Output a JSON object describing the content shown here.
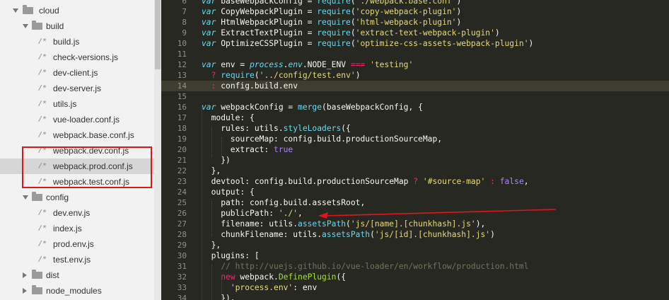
{
  "sidebar": {
    "items": [
      {
        "type": "folder",
        "state": "open",
        "depth": 0,
        "label": "cloud"
      },
      {
        "type": "folder",
        "state": "open",
        "depth": 1,
        "label": "build"
      },
      {
        "type": "file",
        "depth": 2,
        "icon": "/*",
        "label": "build.js"
      },
      {
        "type": "file",
        "depth": 2,
        "icon": "/*",
        "label": "check-versions.js"
      },
      {
        "type": "file",
        "depth": 2,
        "icon": "/*",
        "label": "dev-client.js"
      },
      {
        "type": "file",
        "depth": 2,
        "icon": "/*",
        "label": "dev-server.js"
      },
      {
        "type": "file",
        "depth": 2,
        "icon": "/*",
        "label": "utils.js"
      },
      {
        "type": "file",
        "depth": 2,
        "icon": "/*",
        "label": "vue-loader.conf.js"
      },
      {
        "type": "file",
        "depth": 2,
        "icon": "/*",
        "label": "webpack.base.conf.js"
      },
      {
        "type": "file",
        "depth": 2,
        "icon": "/*",
        "label": "webpack.dev.conf.js"
      },
      {
        "type": "file",
        "depth": 2,
        "icon": "/*",
        "label": "webpack.prod.conf.js",
        "selected": true
      },
      {
        "type": "file",
        "depth": 2,
        "icon": "/*",
        "label": "webpack.test.conf.js"
      },
      {
        "type": "folder",
        "state": "open",
        "depth": 1,
        "label": "config"
      },
      {
        "type": "file",
        "depth": 2,
        "icon": "/*",
        "label": "dev.env.js"
      },
      {
        "type": "file",
        "depth": 2,
        "icon": "/*",
        "label": "index.js"
      },
      {
        "type": "file",
        "depth": 2,
        "icon": "/*",
        "label": "prod.env.js"
      },
      {
        "type": "file",
        "depth": 2,
        "icon": "/*",
        "label": "test.env.js"
      },
      {
        "type": "folder",
        "state": "closed",
        "depth": 1,
        "label": "dist"
      },
      {
        "type": "folder",
        "state": "closed",
        "depth": 1,
        "label": "node_modules"
      }
    ]
  },
  "editor": {
    "active_line": 14,
    "lines": [
      {
        "n": "6",
        "t": [
          [
            "kw",
            "var"
          ],
          [
            "p",
            " baseWebpackConfig = "
          ],
          [
            "fn",
            "require"
          ],
          [
            "p",
            "("
          ],
          [
            "str",
            "'./webpack.base.conf'"
          ],
          [
            "p",
            ")"
          ]
        ]
      },
      {
        "n": "7",
        "t": [
          [
            "kw",
            "var"
          ],
          [
            "p",
            " CopyWebpackPlugin = "
          ],
          [
            "fn",
            "require"
          ],
          [
            "p",
            "("
          ],
          [
            "str",
            "'copy-webpack-plugin'"
          ],
          [
            "p",
            ")"
          ]
        ]
      },
      {
        "n": "8",
        "t": [
          [
            "kw",
            "var"
          ],
          [
            "p",
            " HtmlWebpackPlugin = "
          ],
          [
            "fn",
            "require"
          ],
          [
            "p",
            "("
          ],
          [
            "str",
            "'html-webpack-plugin'"
          ],
          [
            "p",
            ")"
          ]
        ]
      },
      {
        "n": "9",
        "t": [
          [
            "kw",
            "var"
          ],
          [
            "p",
            " ExtractTextPlugin = "
          ],
          [
            "fn",
            "require"
          ],
          [
            "p",
            "("
          ],
          [
            "str",
            "'extract-text-webpack-plugin'"
          ],
          [
            "p",
            ")"
          ]
        ]
      },
      {
        "n": "10",
        "t": [
          [
            "kw",
            "var"
          ],
          [
            "p",
            " OptimizeCSSPlugin = "
          ],
          [
            "fn",
            "require"
          ],
          [
            "p",
            "("
          ],
          [
            "str",
            "'optimize-css-assets-webpack-plugin'"
          ],
          [
            "p",
            ")"
          ]
        ]
      },
      {
        "n": "11",
        "t": []
      },
      {
        "n": "12",
        "t": [
          [
            "kw",
            "var"
          ],
          [
            "p",
            " env = "
          ],
          [
            "env",
            "process"
          ],
          [
            "p",
            "."
          ],
          [
            "env",
            "env"
          ],
          [
            "p",
            ".NODE_ENV "
          ],
          [
            "kw2",
            "==="
          ],
          [
            "p",
            " "
          ],
          [
            "str",
            "'testing'"
          ]
        ]
      },
      {
        "n": "13",
        "t": [
          [
            "p",
            "  "
          ],
          [
            "kw2",
            "?"
          ],
          [
            "p",
            " "
          ],
          [
            "fn",
            "require"
          ],
          [
            "p",
            "("
          ],
          [
            "str",
            "'../config/test.env'"
          ],
          [
            "p",
            ")"
          ]
        ]
      },
      {
        "n": "14",
        "t": [
          [
            "p",
            "  "
          ],
          [
            "kw2",
            ":"
          ],
          [
            "p",
            " config.build.env"
          ]
        ]
      },
      {
        "n": "15",
        "t": []
      },
      {
        "n": "16",
        "t": [
          [
            "kw",
            "var"
          ],
          [
            "p",
            " webpackConfig = "
          ],
          [
            "fn",
            "merge"
          ],
          [
            "p",
            "(baseWebpackConfig, {"
          ]
        ]
      },
      {
        "n": "17",
        "t": [
          [
            "p",
            "  module: {"
          ]
        ]
      },
      {
        "n": "18",
        "t": [
          [
            "p",
            "    rules: utils."
          ],
          [
            "fn",
            "styleLoaders"
          ],
          [
            "p",
            "({"
          ]
        ]
      },
      {
        "n": "19",
        "t": [
          [
            "p",
            "      sourceMap: config.build.productionSourceMap,"
          ]
        ]
      },
      {
        "n": "20",
        "t": [
          [
            "p",
            "      extract: "
          ],
          [
            "bool",
            "true"
          ]
        ]
      },
      {
        "n": "21",
        "t": [
          [
            "p",
            "    })"
          ]
        ]
      },
      {
        "n": "22",
        "t": [
          [
            "p",
            "  },"
          ]
        ]
      },
      {
        "n": "23",
        "t": [
          [
            "p",
            "  devtool: config.build.productionSourceMap "
          ],
          [
            "kw2",
            "?"
          ],
          [
            "p",
            " "
          ],
          [
            "str",
            "'#source-map'"
          ],
          [
            "p",
            " "
          ],
          [
            "kw2",
            ":"
          ],
          [
            "p",
            " "
          ],
          [
            "bool",
            "false"
          ],
          [
            "p",
            ","
          ]
        ]
      },
      {
        "n": "24",
        "t": [
          [
            "p",
            "  output: {"
          ]
        ]
      },
      {
        "n": "25",
        "t": [
          [
            "p",
            "    path: config.build.assetsRoot,"
          ]
        ]
      },
      {
        "n": "26",
        "t": [
          [
            "p",
            "    publicPath: "
          ],
          [
            "str",
            "'./'"
          ],
          [
            "p",
            ","
          ]
        ]
      },
      {
        "n": "27",
        "t": [
          [
            "p",
            "    filename: utils."
          ],
          [
            "fn",
            "assetsPath"
          ],
          [
            "p",
            "("
          ],
          [
            "str",
            "'js/[name].[chunkhash].js'"
          ],
          [
            "p",
            "),"
          ]
        ]
      },
      {
        "n": "28",
        "t": [
          [
            "p",
            "    chunkFilename: utils."
          ],
          [
            "fn",
            "assetsPath"
          ],
          [
            "p",
            "("
          ],
          [
            "str",
            "'js/[id].[chunkhash].js'"
          ],
          [
            "p",
            ")"
          ]
        ]
      },
      {
        "n": "29",
        "t": [
          [
            "p",
            "  },"
          ]
        ]
      },
      {
        "n": "30",
        "t": [
          [
            "p",
            "  plugins: ["
          ]
        ]
      },
      {
        "n": "31",
        "t": [
          [
            "p",
            "    "
          ],
          [
            "cm",
            "// http://vuejs.github.io/vue-loader/en/workflow/production.html"
          ]
        ]
      },
      {
        "n": "32",
        "t": [
          [
            "p",
            "    "
          ],
          [
            "kw2",
            "new"
          ],
          [
            "p",
            " webpack."
          ],
          [
            "call",
            "DefinePlugin"
          ],
          [
            "p",
            "({"
          ]
        ]
      },
      {
        "n": "33",
        "t": [
          [
            "p",
            "      "
          ],
          [
            "str",
            "'process.env'"
          ],
          [
            "p",
            ": env"
          ]
        ]
      },
      {
        "n": "34",
        "t": [
          [
            "p",
            "    }),"
          ]
        ]
      }
    ]
  },
  "colors": {
    "annotation": "#e0161b",
    "editor_bg": "#272822",
    "sidebar_bg": "#f2f2f2"
  }
}
